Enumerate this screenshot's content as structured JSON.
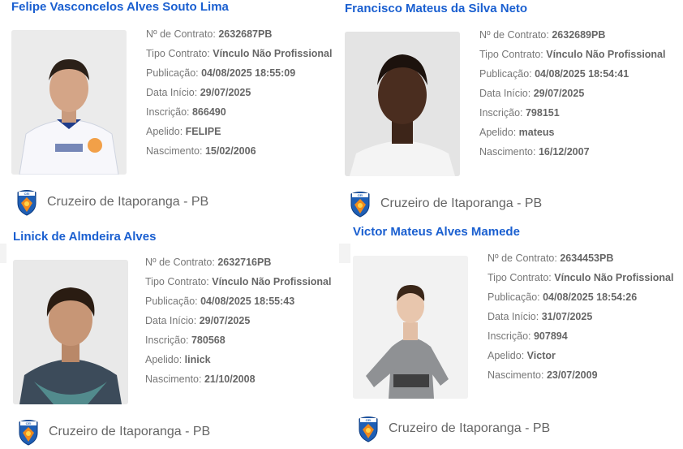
{
  "labels": {
    "contrato": "Nº de Contrato:",
    "tipo": "Tipo Contrato:",
    "publicacao": "Publicação:",
    "data_inicio": "Data Início:",
    "inscricao": "Inscrição:",
    "apelido": "Apelido:",
    "nascimento": "Nascimento:"
  },
  "athletes": [
    {
      "name": "Felipe Vasconcelos Alves Souto Lima",
      "contrato": "2632687PB",
      "tipo": "Vínculo Não Profissional",
      "publicacao": "04/08/2025 18:55:09",
      "data_inicio": "29/07/2025",
      "inscricao": "866490",
      "apelido": "FELIPE",
      "nascimento": "15/02/2006",
      "club": "Cruzeiro de Itaporanga - PB",
      "photo_icon": "athlete-photo-white-jersey"
    },
    {
      "name": "Francisco Mateus da Silva Neto",
      "contrato": "2632689PB",
      "tipo": "Vínculo Não Profissional",
      "publicacao": "04/08/2025 18:54:41",
      "data_inicio": "29/07/2025",
      "inscricao": "798151",
      "apelido": "mateus",
      "nascimento": "16/12/2007",
      "club": "Cruzeiro de Itaporanga - PB",
      "photo_icon": "athlete-photo-portrait"
    },
    {
      "name": "Linick de Almdeira Alves",
      "contrato": "2632716PB",
      "tipo": "Vínculo Não Profissional",
      "publicacao": "04/08/2025 18:55:43",
      "data_inicio": "29/07/2025",
      "inscricao": "780568",
      "apelido": "linick",
      "nascimento": "21/10/2008",
      "club": "Cruzeiro de Itaporanga - PB",
      "photo_icon": "athlete-photo-portrait"
    },
    {
      "name": "Victor Mateus Alves Mamede",
      "contrato": "2634453PB",
      "tipo": "Vínculo Não Profissional",
      "publicacao": "04/08/2025 18:54:26",
      "data_inicio": "31/07/2025",
      "inscricao": "907894",
      "apelido": "Victor",
      "nascimento": "23/07/2009",
      "club": "Cruzeiro de Itaporanga - PB",
      "photo_icon": "athlete-photo-grey-jersey"
    }
  ],
  "colors": {
    "name_link": "#1a5fd0",
    "text_grey": "#777777",
    "crest_blue": "#1f5fb5",
    "crest_orange": "#f08a1c"
  },
  "icons": {
    "club_crest": "club-crest-icon"
  }
}
